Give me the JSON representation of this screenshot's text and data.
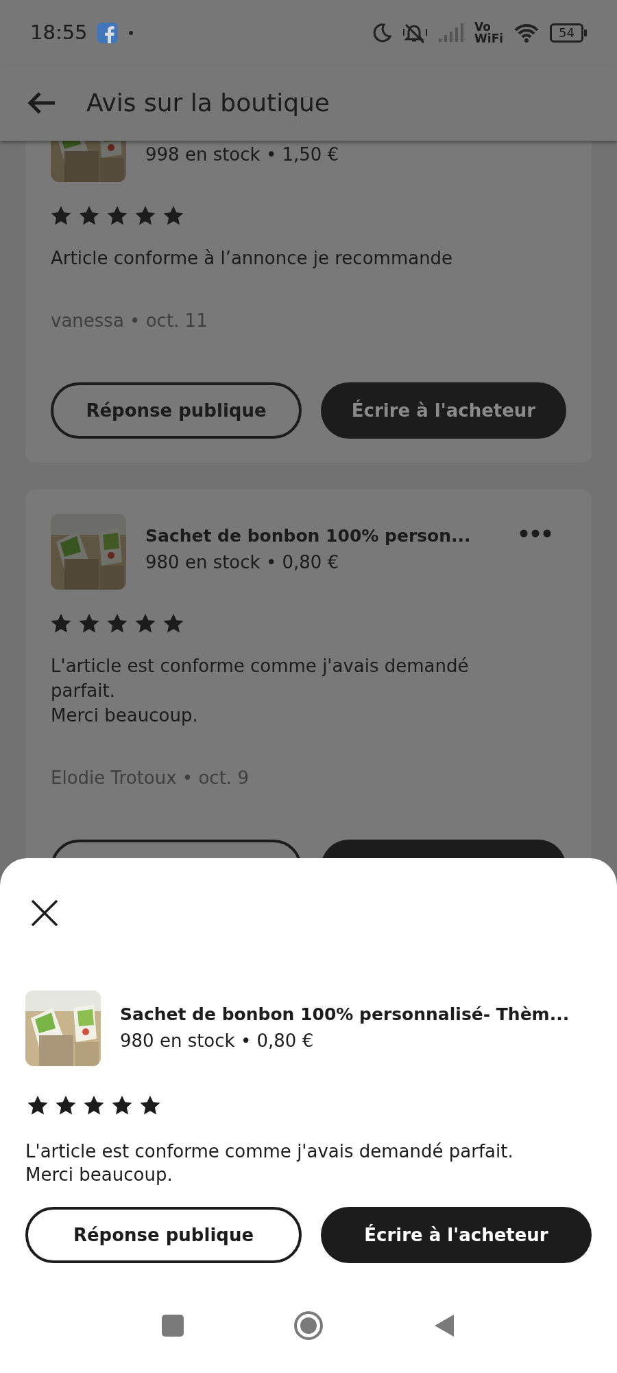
{
  "status_bar": {
    "time": "18:55",
    "network_label_top": "Vo",
    "network_label_bottom": "WiFi",
    "battery": "54"
  },
  "app_bar": {
    "title": "Avis sur la boutique"
  },
  "reviews": [
    {
      "stock": "998 en stock • 1,50 €",
      "stars": 5,
      "comment": "Article conforme à l’annonce je recommande",
      "author": "vanessa • oct. 11",
      "buttons": [
        {
          "label": "Réponse publique",
          "kind": "outline"
        },
        {
          "label": "Écrire à l'acheteur",
          "kind": "filled"
        }
      ]
    },
    {
      "title": "Sachet de bonbon 100% person...",
      "stock": "980 en stock • 0,80 €",
      "stars": 5,
      "comment": "L'article est conforme comme j'avais demandé parfait.\nMerci beaucoup.",
      "author": "Elodie Trotoux • oct. 9",
      "buttons": [
        {
          "kind": "outline"
        },
        {
          "kind": "filled"
        }
      ]
    }
  ],
  "sheet": {
    "title": "Sachet de bonbon 100% personnalisé- Thèm...",
    "stock": "980 en stock • 0,80 €",
    "stars": 5,
    "comment": "L'article est conforme comme j'avais demandé parfait.\nMerci beaucoup.",
    "buttons": [
      {
        "label": "Réponse publique",
        "kind": "outline"
      },
      {
        "label": "Écrire à l'acheteur",
        "kind": "filled"
      }
    ]
  }
}
